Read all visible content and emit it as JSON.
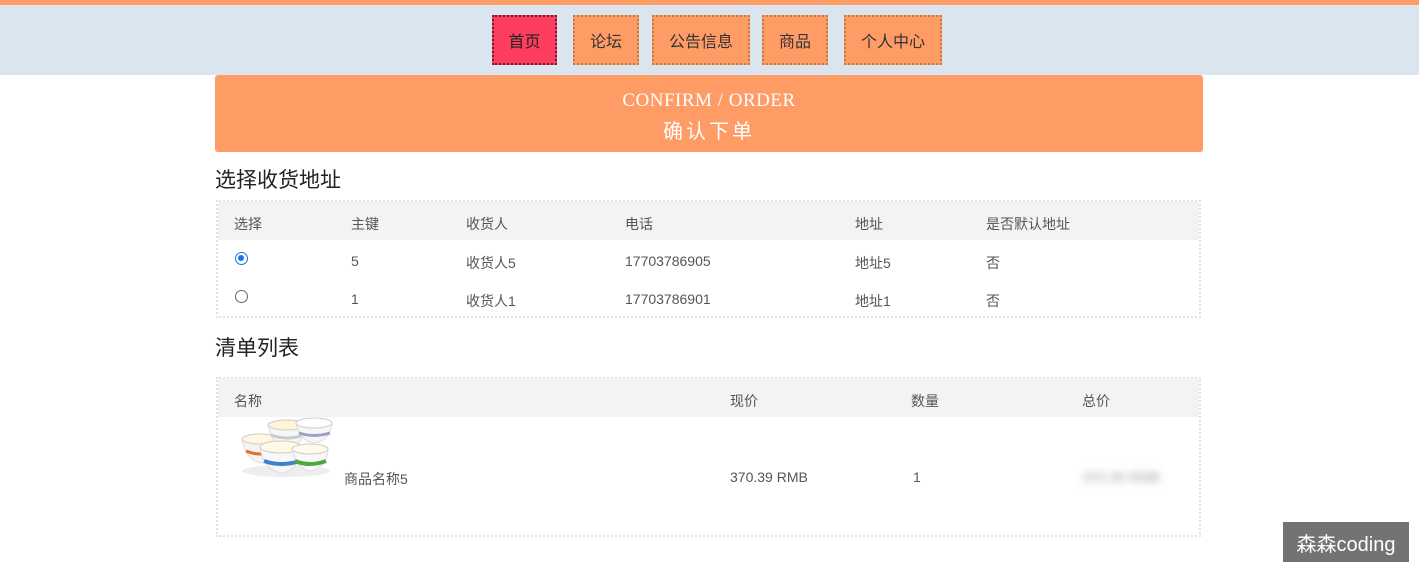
{
  "nav": {
    "items": [
      {
        "label": "首页",
        "active": true
      },
      {
        "label": "论坛",
        "active": false
      },
      {
        "label": "公告信息",
        "active": false
      },
      {
        "label": "商品",
        "active": false
      },
      {
        "label": "个人中心",
        "active": false
      }
    ]
  },
  "banner": {
    "title_en": "CONFIRM / ORDER",
    "title_cn": "确认下单"
  },
  "address": {
    "section_title": "选择收货地址",
    "headers": [
      "选择",
      "主键",
      "收货人",
      "电话",
      "地址",
      "是否默认地址"
    ],
    "rows": [
      {
        "selected": true,
        "id": "5",
        "name": "收货人5",
        "phone": "17703786905",
        "addr": "地址5",
        "default": "否"
      },
      {
        "selected": false,
        "id": "1",
        "name": "收货人1",
        "phone": "17703786901",
        "addr": "地址1",
        "default": "否"
      }
    ]
  },
  "cart": {
    "section_title": "清单列表",
    "headers": [
      "名称",
      "现价",
      "数量",
      "总价"
    ],
    "items": [
      {
        "name": "商品名称5",
        "price": "370.39 RMB",
        "qty": "1",
        "total": "370.39 RMB"
      }
    ]
  },
  "watermark": "森森coding",
  "colors": {
    "accent": "#ff9c66",
    "active_nav": "#fe3d60",
    "navbar_bg": "#dbe5f0"
  }
}
